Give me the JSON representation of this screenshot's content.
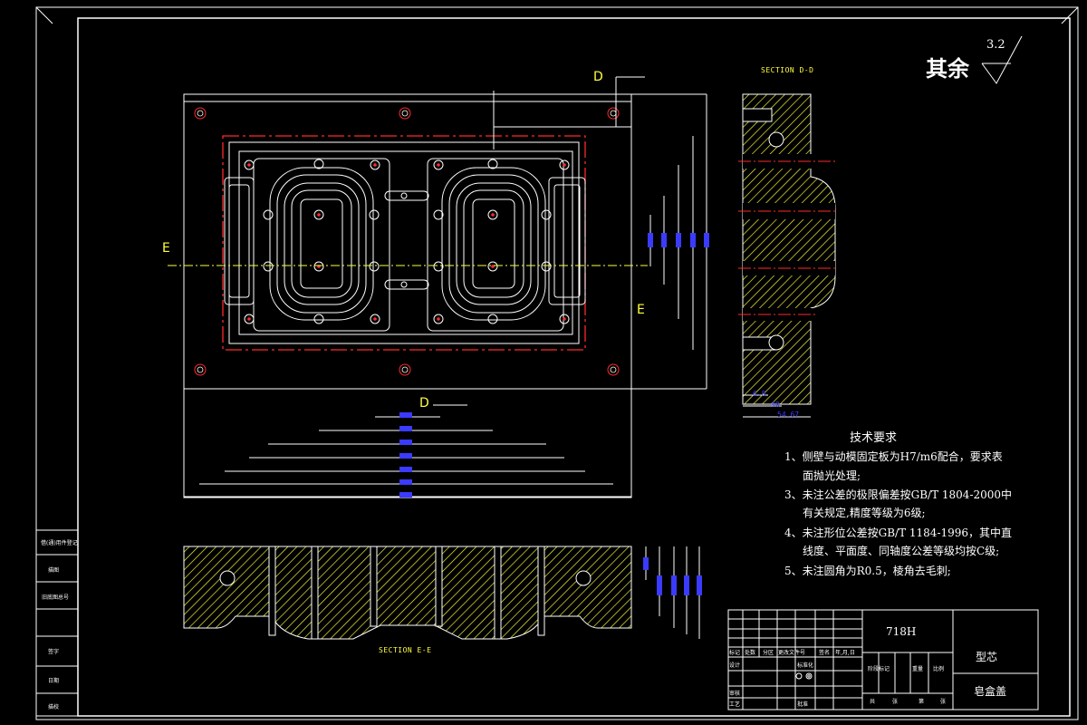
{
  "drawing": {
    "surface_finish": {
      "label": "其余",
      "value": "3.2"
    },
    "section_dd_label": "SECTION D-D",
    "section_ee_label": "SECTION E-E",
    "cut_letters": {
      "d_top": "D",
      "d_bottom": "D",
      "e_left": "E",
      "e_right": "E"
    },
    "side_dims": [
      "6.8",
      "40",
      "54.67"
    ]
  },
  "tech_requirements": {
    "title": "技术要求",
    "items": [
      "1、侧壁与动模固定板为H7/m6配合，要求表",
      "面抛光处理;",
      "3、未注公差的极限偏差按GB/T 1804-2000中",
      "有关规定,精度等级为6级;",
      "4、未注形位公差按GB/T 1184-1996，其中直",
      "线度、平面度、同轴度公差等级均按C级;",
      "5、未注圆角为R0.5，棱角去毛刺;"
    ]
  },
  "title_block": {
    "material": "718H",
    "part_name": "型芯",
    "product_name": "皂盒盖",
    "row_labels": [
      "标记",
      "处数",
      "分区",
      "更改文件号",
      "签名",
      "年,月,日"
    ],
    "design_label": "设计",
    "standard_label": "标准化",
    "process_label": "工艺",
    "review_label": "审核",
    "approve_label": "批准",
    "stage_labels": [
      "阶段标记",
      "重量",
      "比例"
    ],
    "sheet_labels": [
      "共",
      "张",
      "第",
      "张"
    ]
  },
  "side_column": {
    "labels": [
      "借(通)用件登记",
      "旧底图总号",
      "签字",
      "日期",
      "描图",
      "描校"
    ]
  },
  "colors": {
    "background": "#000000",
    "lines": "#ffffff",
    "centerline": "#ff2a2a",
    "dimension": "#3b3bff",
    "highlight": "#ffff3a"
  }
}
